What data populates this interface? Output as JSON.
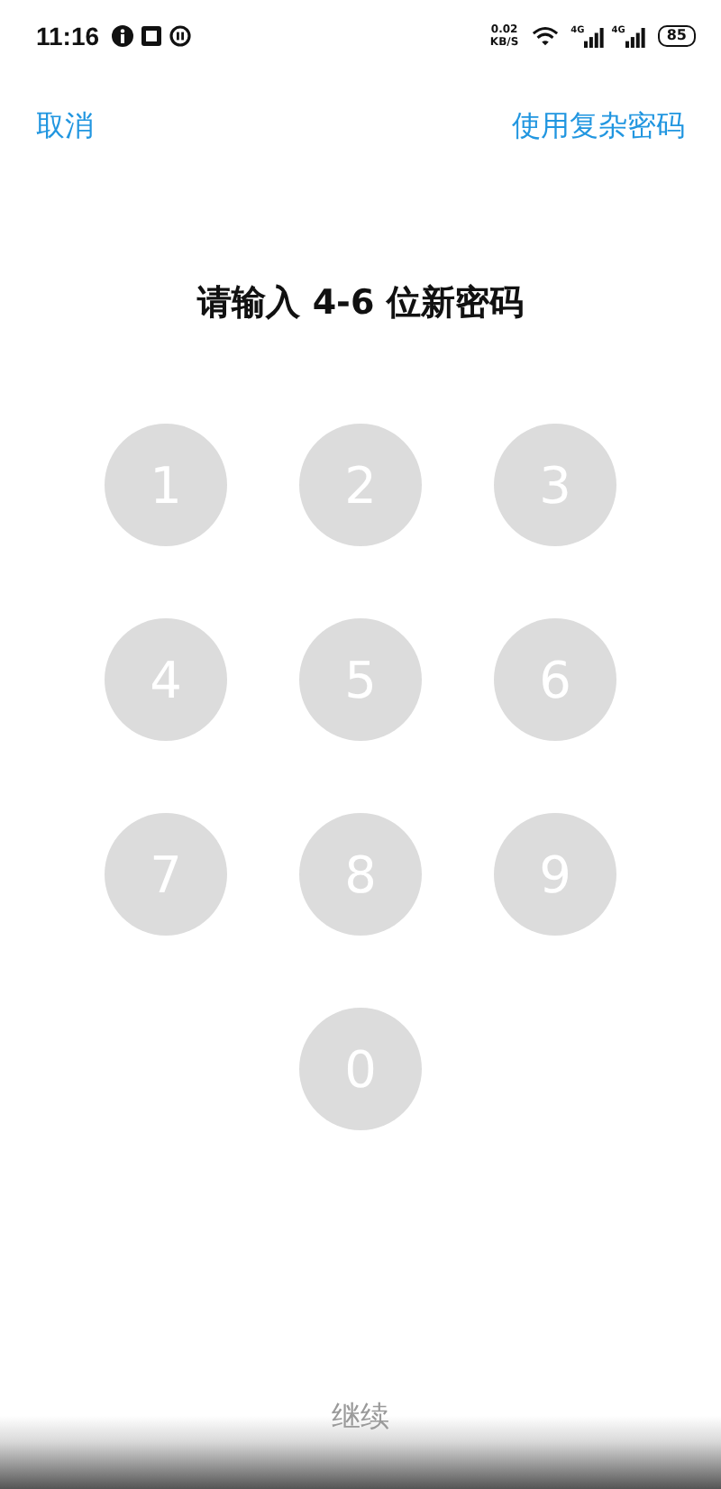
{
  "status_bar": {
    "time": "11:16",
    "speed_value": "0.02",
    "speed_unit": "KB/S",
    "network_labels": [
      "4G",
      "4G"
    ],
    "battery": "85"
  },
  "top_bar": {
    "cancel": "取消",
    "complex_password": "使用复杂密码"
  },
  "title": "请输入 4-6 位新密码",
  "keys": [
    "1",
    "2",
    "3",
    "4",
    "5",
    "6",
    "7",
    "8",
    "9",
    "0"
  ],
  "continue_button": {
    "label": "继续",
    "disabled": true
  }
}
